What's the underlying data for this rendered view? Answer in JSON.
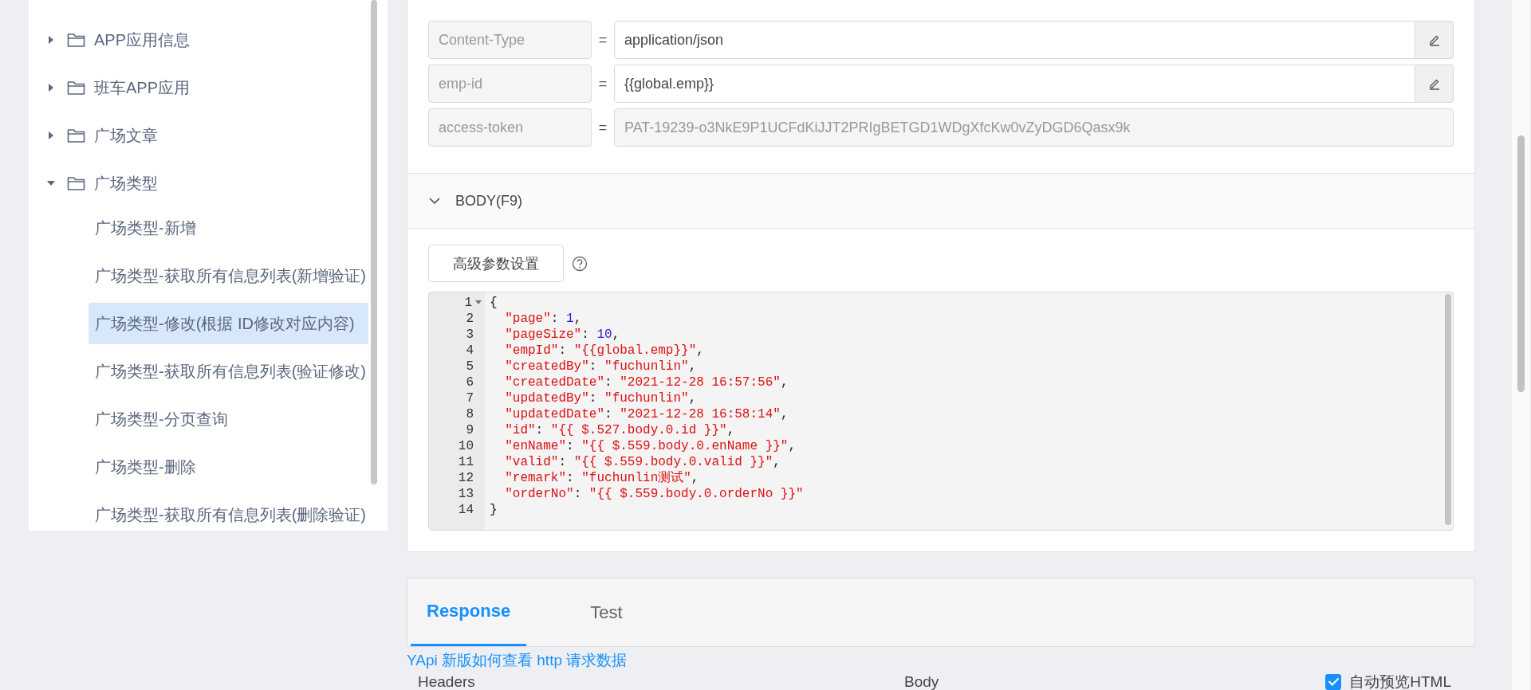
{
  "sidebar": {
    "tree": [
      {
        "label": "APP应用信息",
        "expanded": false,
        "selected": false
      },
      {
        "label": "班车APP应用",
        "expanded": false,
        "selected": false
      },
      {
        "label": "广场文章",
        "expanded": false,
        "selected": false
      },
      {
        "label": "广场类型",
        "expanded": true,
        "selected": false,
        "children": [
          {
            "label": "广场类型-新增",
            "selected": false
          },
          {
            "label": "广场类型-获取所有信息列表(新增验证)",
            "selected": false
          },
          {
            "label": "广场类型-修改(根据 ID修改对应内容)",
            "selected": true
          },
          {
            "label": "广场类型-获取所有信息列表(验证修改)",
            "selected": false
          },
          {
            "label": "广场类型-分页查询",
            "selected": false
          },
          {
            "label": "广场类型-删除",
            "selected": false
          },
          {
            "label": "广场类型-获取所有信息列表(删除验证)",
            "selected": false
          }
        ]
      }
    ]
  },
  "headers": [
    {
      "name": "Content-Type",
      "equals": "=",
      "value": "application/json",
      "editable": true,
      "disabled": false
    },
    {
      "name": "emp-id",
      "equals": "=",
      "value": "{{global.emp}}",
      "editable": true,
      "disabled": false
    },
    {
      "name": "access-token",
      "equals": "=",
      "value": "PAT-19239-o3NkE9P1UCFdKiJJT2PRIgBETGD1WDgXfcKw0vZyDGD6Qasx9k",
      "editable": false,
      "disabled": true
    }
  ],
  "body": {
    "title": "BODY(F9)",
    "expanded": true,
    "advanced_button": "高级参数设置",
    "code": [
      {
        "number": "1",
        "text": "{"
      },
      {
        "number": "2",
        "text": "  \"page\": 1,"
      },
      {
        "number": "3",
        "text": "  \"pageSize\": 10,"
      },
      {
        "number": "4",
        "text": "  \"empId\": \"{{global.emp}}\","
      },
      {
        "number": "5",
        "text": "  \"createdBy\": \"fuchunlin\","
      },
      {
        "number": "6",
        "text": "  \"createdDate\": \"2021-12-28 16:57:56\","
      },
      {
        "number": "7",
        "text": "  \"updatedBy\": \"fuchunlin\","
      },
      {
        "number": "8",
        "text": "  \"updatedDate\": \"2021-12-28 16:58:14\","
      },
      {
        "number": "9",
        "text": "  \"id\": \"{{ $.527.body.0.id }}\","
      },
      {
        "number": "10",
        "text": "  \"enName\": \"{{ $.559.body.0.enName }}\","
      },
      {
        "number": "11",
        "text": "  \"valid\": \"{{ $.559.body.0.valid }}\","
      },
      {
        "number": "12",
        "text": "  \"remark\": \"fuchunlin测试\","
      },
      {
        "number": "13",
        "text": "  \"orderNo\": \"{{ $.559.body.0.orderNo }}\""
      },
      {
        "number": "14",
        "text": "}"
      }
    ]
  },
  "response": {
    "tabs": [
      {
        "label": "Response",
        "selected": true
      },
      {
        "label": "Test",
        "selected": false
      }
    ],
    "help_link": "YApi 新版如何查看 http 请求数据",
    "columns": [
      "Headers",
      "Body"
    ],
    "preview": {
      "label": "自动预览HTML",
      "checked": true
    }
  }
}
